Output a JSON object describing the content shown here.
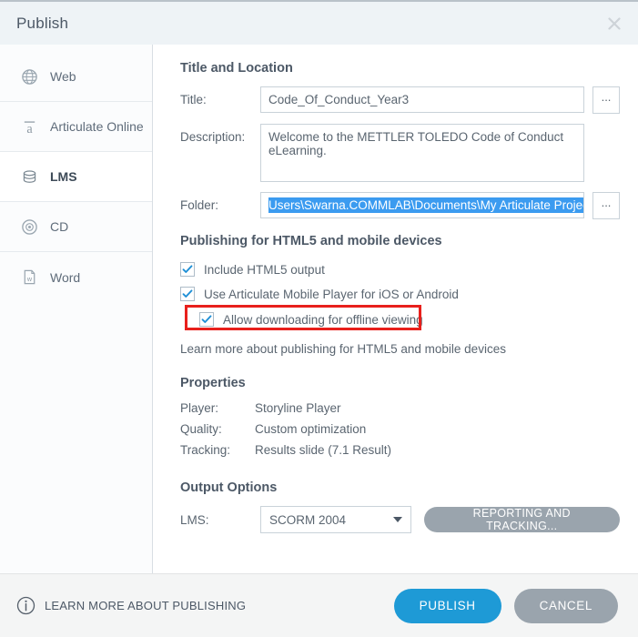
{
  "window": {
    "title": "Publish",
    "close_icon": "close-icon"
  },
  "sidebar": {
    "items": [
      {
        "label": "Web",
        "icon": "globe-icon",
        "selected": false
      },
      {
        "label": "Articulate Online",
        "icon": "articulate-a-icon",
        "selected": false
      },
      {
        "label": "LMS",
        "icon": "database-icon",
        "selected": true
      },
      {
        "label": "CD",
        "icon": "disc-icon",
        "selected": false
      },
      {
        "label": "Word",
        "icon": "word-document-icon",
        "selected": false
      }
    ]
  },
  "title_location": {
    "heading": "Title and Location",
    "title_label": "Title:",
    "title_value": "Code_Of_Conduct_Year3",
    "description_label": "Description:",
    "description_value": "Welcome to the METTLER TOLEDO Code of Conduct eLearning.",
    "folder_label": "Folder:",
    "folder_value": "Users\\Swarna.COMMLAB\\Documents\\My Articulate Projects",
    "browse_label": "...",
    "folder_text_selected": true
  },
  "html5_section": {
    "heading": "Publishing for HTML5 and mobile devices",
    "checkboxes": [
      {
        "label": "Include HTML5 output",
        "checked": true,
        "indented": false,
        "highlighted": false
      },
      {
        "label": "Use Articulate Mobile Player for iOS or Android",
        "checked": true,
        "indented": false,
        "highlighted": false
      },
      {
        "label": "Allow downloading for offline viewing",
        "checked": true,
        "indented": true,
        "highlighted": true
      }
    ],
    "learn_more": "Learn more about publishing for HTML5 and mobile devices",
    "highlight_color": "#e8201c"
  },
  "properties": {
    "heading": "Properties",
    "rows": [
      {
        "label": "Player:",
        "value": "Storyline Player"
      },
      {
        "label": "Quality:",
        "value": "Custom optimization"
      },
      {
        "label": "Tracking:",
        "value": "Results slide (7.1 Result)"
      }
    ]
  },
  "output_options": {
    "heading": "Output Options",
    "lms_label": "LMS:",
    "lms_value": "SCORM 2004",
    "lms_options": [
      "SCORM 2004"
    ],
    "reporting_button": "REPORTING AND TRACKING..."
  },
  "footer": {
    "info_icon": "info-icon",
    "learn_more": "LEARN MORE ABOUT PUBLISHING",
    "publish_button": "PUBLISH",
    "cancel_button": "CANCEL",
    "publish_color": "#1e9ad6",
    "cancel_color": "#9aa4ad"
  }
}
